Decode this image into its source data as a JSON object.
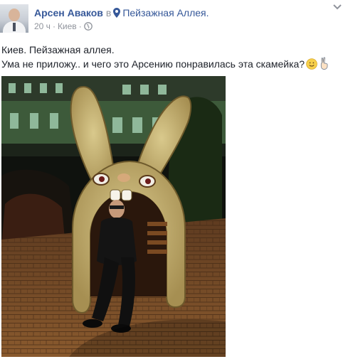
{
  "post": {
    "author": "Арсен Аваков",
    "in_word": "в",
    "place": "Пейзажная Аллея.",
    "time": "20 ч",
    "separator1": "·",
    "location": "Киев",
    "separator2": "·",
    "text_line1": "Киев. Пейзажная аллея.",
    "text_line2": "Ума не приложу.. и чего это Арсению понравилась эта скамейка?",
    "icons": {
      "avatar": "profile-photo",
      "place": "map-pin-icon",
      "privacy": "globe-icon",
      "menu": "chevron-down-icon",
      "emoji1": "smiling-face-emoji",
      "emoji2": "victory-hand-emoji"
    },
    "colors": {
      "link": "#365899",
      "meta": "#90949c",
      "text": "#1d2129"
    }
  }
}
